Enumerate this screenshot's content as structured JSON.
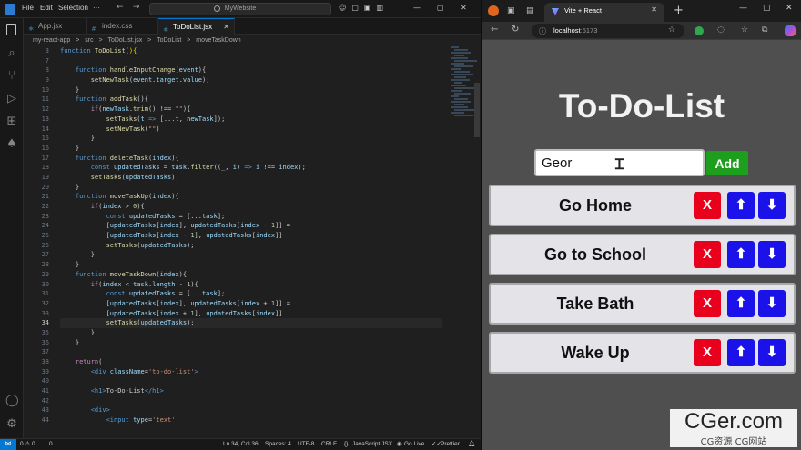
{
  "vscode": {
    "menu": [
      "File",
      "Edit",
      "Selection"
    ],
    "search_placeholder": "MyWebsite",
    "tabs": [
      {
        "label": "App.jsx",
        "active": false
      },
      {
        "label": "index.css",
        "active": false
      },
      {
        "label": "ToDoList.jsx",
        "active": true
      }
    ],
    "breadcrumb": [
      "my-react-app",
      ">",
      "src",
      ">",
      "ToDoList.jsx",
      ">",
      "ToDoList",
      ">",
      "moveTaskDown"
    ],
    "line_numbers": [
      "3",
      "7",
      "8",
      "9",
      "10",
      "11",
      "12",
      "13",
      "14",
      "15",
      "16",
      "17",
      "18",
      "19",
      "20",
      "21",
      "22",
      "23",
      "24",
      "25",
      "26",
      "27",
      "28",
      "29",
      "30",
      "31",
      "32",
      "33",
      "34",
      "35",
      "36",
      "37",
      "38",
      "39",
      "40",
      "41",
      "42",
      "43",
      "44"
    ],
    "current_line": "34",
    "status": {
      "problems": "0 ⚠ 0",
      "warnings": "0",
      "position": "Ln 34, Col 36",
      "spaces": "Spaces: 4",
      "encoding": "UTF-8",
      "eol": "CRLF",
      "language": "JavaScript JSX",
      "golive": "Go Live",
      "prettier": "Prettier"
    }
  },
  "browser": {
    "tab_title": "Vite + React",
    "url_host": "localhost",
    "url_port": ":5173"
  },
  "app": {
    "title": "To-Do-List",
    "input_value": "Geor",
    "add_label": "Add",
    "tasks": [
      {
        "text": "Go Home"
      },
      {
        "text": "Go to School"
      },
      {
        "text": "Take Bath"
      },
      {
        "text": "Wake Up"
      }
    ],
    "delete_label": "X",
    "up_label": "⬆",
    "down_label": "⬇"
  },
  "watermark": {
    "main": "CGer.com",
    "sub": "CG资源 CG网站"
  },
  "colors": {
    "add_button": "#1d9e1d",
    "delete_button": "#e8001c",
    "move_buttons": "#1a12e8",
    "app_background": "#4f4f4f"
  }
}
